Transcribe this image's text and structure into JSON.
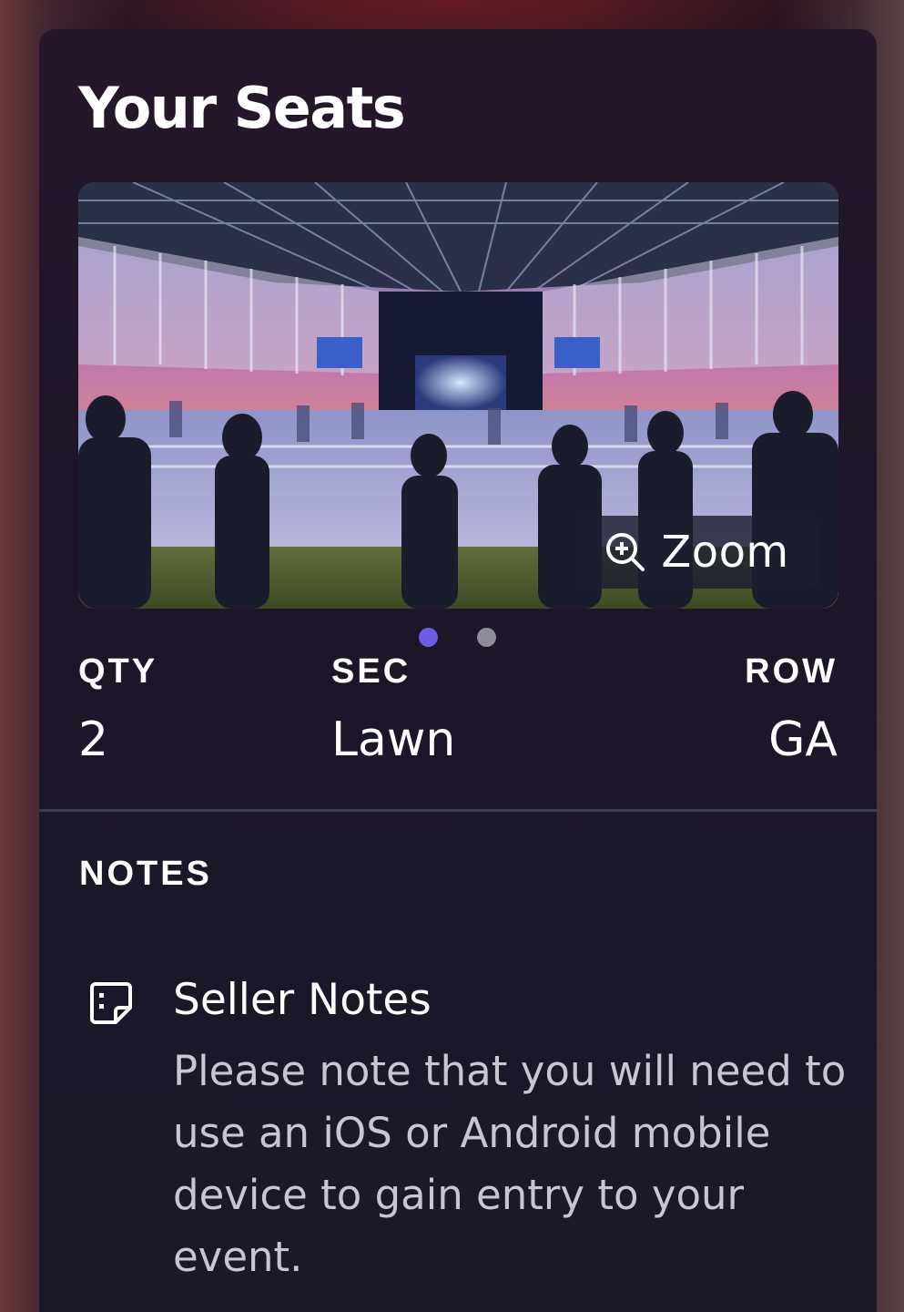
{
  "card": {
    "title": "Your Seats",
    "image": {
      "alt_scene": "amphitheater-lawn-view",
      "zoom_label": "Zoom",
      "zoom_icon": "zoom-in-icon"
    },
    "carousel": {
      "total": 2,
      "active_index": 0,
      "active_color": "#6c5ce7",
      "idle_color": "#8e8c96"
    },
    "seat_info": {
      "qty_label": "QTY",
      "qty_value": "2",
      "sec_label": "SEC",
      "sec_value": "Lawn",
      "row_label": "ROW",
      "row_value": "GA"
    },
    "notes": {
      "heading": "NOTES",
      "items": [
        {
          "icon": "sticky-note-icon",
          "title": "Seller Notes",
          "body": "Please note that you will need to use an iOS or Android mobile device to gain entry to your event."
        }
      ]
    }
  }
}
